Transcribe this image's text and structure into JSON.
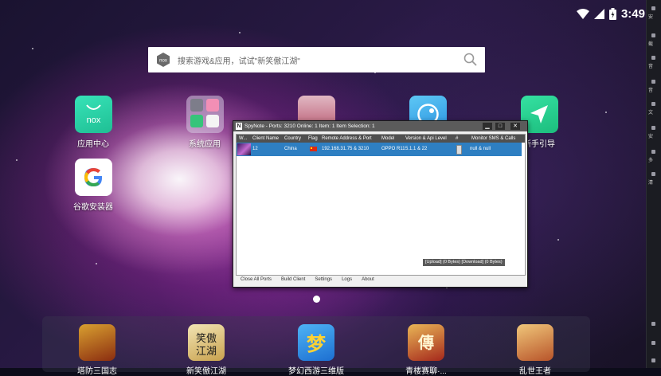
{
  "statusbar": {
    "time": "3:49",
    "icons": [
      "wifi-icon",
      "signal-icon",
      "battery-icon"
    ]
  },
  "right_panel": {
    "items": [
      "安",
      "截",
      "音",
      "音",
      "文",
      "安",
      "多",
      "清"
    ]
  },
  "search": {
    "placeholder": "搜索游戏&应用，试试\"新笑傲江湖\"",
    "logo": "nox"
  },
  "apps": [
    {
      "label": "应用中心",
      "icon": "nox-store-icon"
    },
    {
      "label": "系统应用",
      "icon": "system-apps-folder-icon"
    },
    {
      "label": "新手引导",
      "icon": "guide-arrow-icon"
    },
    {
      "label": "谷歌安装器",
      "icon": "google-icon"
    }
  ],
  "dock": [
    {
      "label": "塔防三国志",
      "icon": "game-warrior-icon"
    },
    {
      "label": "新笑傲江湖",
      "icon": "game-xiaoao-icon"
    },
    {
      "label": "梦幻西游三维版",
      "icon": "game-menghuan-icon"
    },
    {
      "label": "青楼赛聊·...",
      "icon": "game-chuanqi-icon"
    },
    {
      "label": "乱世王者",
      "icon": "game-king-icon"
    }
  ],
  "spynote": {
    "title": "SpyNote - Ports: 3210 Online: 1 Item: 1 Item Selection: 1",
    "buttons": {
      "minimize": "▁",
      "maximize": "□",
      "close": "✕"
    },
    "columns": [
      "W...",
      "Client Name",
      "Country",
      "Flag",
      "Remote Address & Port",
      "Model",
      "Version & Api Level",
      "#",
      "Monitor SMS & Calls"
    ],
    "rows": [
      {
        "client_name": "12",
        "country": "China",
        "remote": "192.168.31.75 & 3210",
        "model": "OPPO R11",
        "version": "5.1.1 & 22",
        "monitor": "null & null"
      }
    ],
    "transfer": "[Upload] (0 Bytes) [Download] (0 Bytes)",
    "menu": [
      "Close All Ports",
      "Build Client",
      "Settings",
      "Logs",
      "About"
    ]
  }
}
